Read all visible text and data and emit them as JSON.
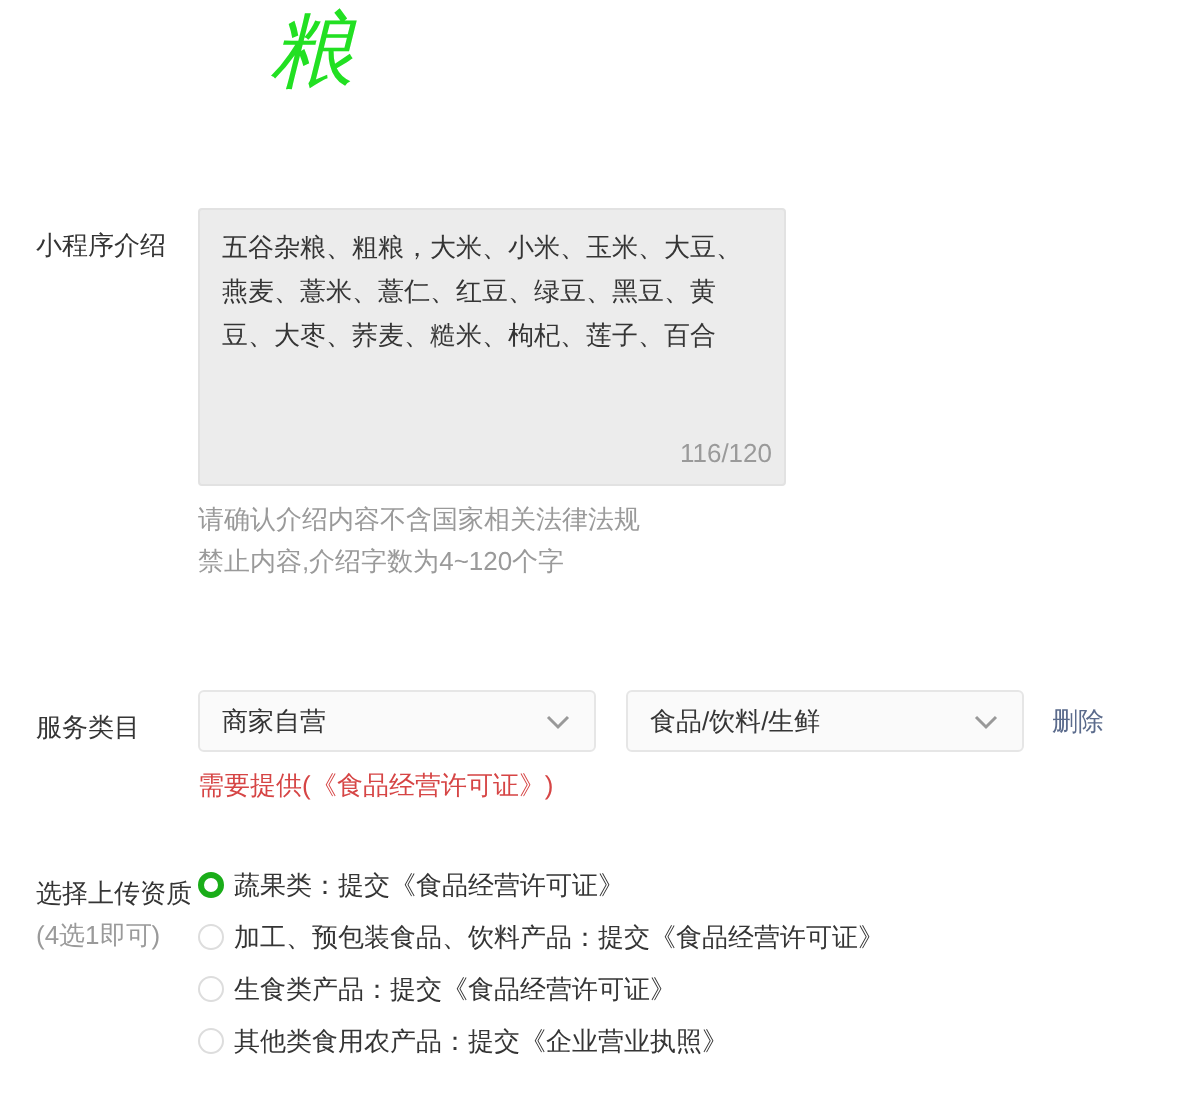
{
  "logo_text": "粮",
  "intro": {
    "label": "小程序介绍",
    "value": "五谷杂粮、粗粮，大米、小米、玉米、大豆、燕麦、薏米、薏仁、红豆、绿豆、黑豆、黄豆、大枣、荞麦、糙米、枸杞、莲子、百合",
    "counter": "116/120",
    "hints": [
      "请确认介绍内容不含国家相关法律法规",
      "禁止内容,介绍字数为4~120个字"
    ]
  },
  "service": {
    "label": "服务类目",
    "selects": [
      "商家自营",
      "食品/饮料/生鲜"
    ],
    "delete": "删除",
    "warning": "需要提供(《食品经营许可证》)"
  },
  "qualification": {
    "label": "选择上传资质",
    "sublabel": "(4选1即可)",
    "options": [
      {
        "label": "蔬果类：提交《食品经营许可证》",
        "selected": true
      },
      {
        "label": "加工、预包装食品、饮料产品：提交《食品经营许可证》",
        "selected": false
      },
      {
        "label": "生食类产品：提交《食品经营许可证》",
        "selected": false
      },
      {
        "label": "其他类食用农产品：提交《企业营业执照》",
        "selected": false
      }
    ]
  }
}
